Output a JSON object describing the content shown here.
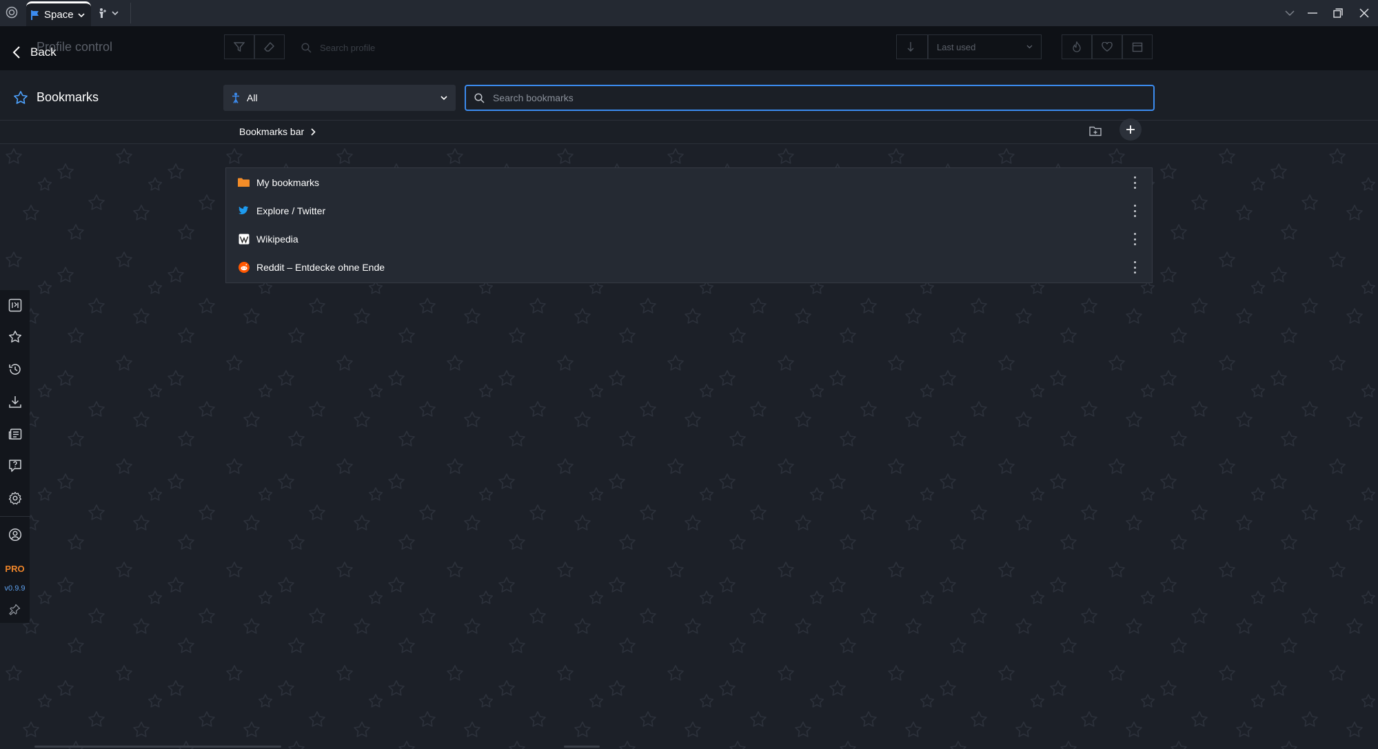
{
  "titlebar": {
    "tab_space_label": "Space"
  },
  "profile_control": {
    "title": "Profile control",
    "back_label": "Back",
    "search_placeholder": "Search profile",
    "sort_value": "Last used"
  },
  "bookmarks": {
    "title": "Bookmarks",
    "filter_value": "All",
    "search_placeholder": "Search bookmarks",
    "breadcrumb": "Bookmarks bar",
    "items": [
      {
        "label": "My bookmarks",
        "icon": "folder-icon"
      },
      {
        "label": "Explore / Twitter",
        "icon": "twitter-icon"
      },
      {
        "label": "Wikipedia",
        "icon": "wikipedia-icon"
      },
      {
        "label": "Reddit – Entdecke ohne Ende",
        "icon": "reddit-icon"
      }
    ]
  },
  "sidebar": {
    "pro_label": "PRO",
    "version": "v0.9.9"
  },
  "colors": {
    "accent_blue": "#3c8cf0",
    "pro_orange": "#f0862a",
    "folder_orange": "#f28c28",
    "twitter_blue": "#1d9bf0",
    "reddit_orange": "#ff5700"
  }
}
